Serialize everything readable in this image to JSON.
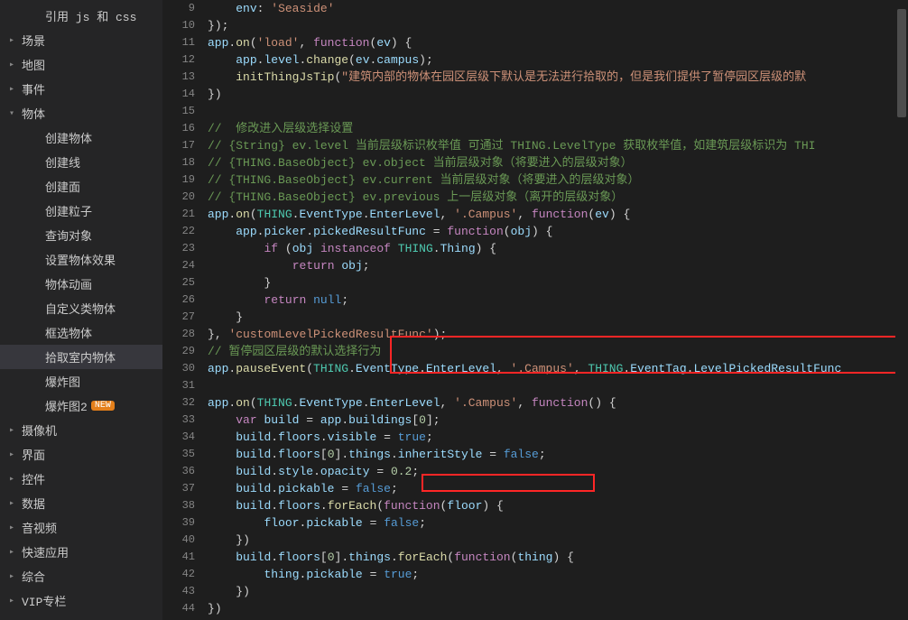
{
  "sidebar": {
    "items": [
      {
        "label": "引用 js 和 css",
        "arrow": "",
        "child": true
      },
      {
        "label": "场景",
        "arrow": "▸"
      },
      {
        "label": "地图",
        "arrow": "▸"
      },
      {
        "label": "事件",
        "arrow": "▸"
      },
      {
        "label": "物体",
        "arrow": "▾"
      },
      {
        "label": "创建物体",
        "arrow": "",
        "child": true
      },
      {
        "label": "创建线",
        "arrow": "",
        "child": true
      },
      {
        "label": "创建面",
        "arrow": "",
        "child": true
      },
      {
        "label": "创建粒子",
        "arrow": "",
        "child": true
      },
      {
        "label": "查询对象",
        "arrow": "",
        "child": true
      },
      {
        "label": "设置物体效果",
        "arrow": "",
        "child": true
      },
      {
        "label": "物体动画",
        "arrow": "",
        "child": true
      },
      {
        "label": "自定义类物体",
        "arrow": "",
        "child": true
      },
      {
        "label": "框选物体",
        "arrow": "",
        "child": true
      },
      {
        "label": "拾取室内物体",
        "arrow": "",
        "child": true,
        "selected": true
      },
      {
        "label": "爆炸图",
        "arrow": "",
        "child": true
      },
      {
        "label": "爆炸图2",
        "arrow": "",
        "child": true,
        "badge": "NEW"
      },
      {
        "label": "摄像机",
        "arrow": "▸"
      },
      {
        "label": "界面",
        "arrow": "▸"
      },
      {
        "label": "控件",
        "arrow": "▸"
      },
      {
        "label": "数据",
        "arrow": "▸"
      },
      {
        "label": "音视频",
        "arrow": "▸"
      },
      {
        "label": "快速应用",
        "arrow": "▸"
      },
      {
        "label": "综合",
        "arrow": "▸"
      },
      {
        "label": "VIP专栏",
        "arrow": "▸"
      }
    ]
  },
  "code": {
    "first_line": 9,
    "lines": [
      "    env: 'Seaside'",
      "});",
      "app.on('load', function(ev) {",
      "    app.level.change(ev.campus);",
      "    initThingJsTip(\"建筑内部的物体在园区层级下默认是无法进行拾取的，但是我们提供了暂停园区层级的默",
      "})",
      "",
      "//  修改进入层级选择设置",
      "// {String} ev.level 当前层级标识枚举值 可通过 THING.LevelType 获取枚举值，如建筑层级标识为 THI",
      "// {THING.BaseObject} ev.object 当前层级对象（将要进入的层级对象）",
      "// {THING.BaseObject} ev.current 当前层级对象（将要进入的层级对象）",
      "// {THING.BaseObject} ev.previous 上一层级对象（离开的层级对象）",
      "app.on(THING.EventType.EnterLevel, '.Campus', function(ev) {",
      "    app.picker.pickedResultFunc = function(obj) {",
      "        if (obj instanceof THING.Thing) {",
      "            return obj;",
      "        }",
      "        return null;",
      "    }",
      "}, 'customLevelPickedResultFunc');",
      "// 暂停园区层级的默认选择行为",
      "app.pauseEvent(THING.EventType.EnterLevel, '.Campus', THING.EventTag.LevelPickedResultFunc",
      "",
      "app.on(THING.EventType.EnterLevel, '.Campus', function() {",
      "    var build = app.buildings[0];",
      "    build.floors.visible = true;",
      "    build.floors[0].things.inheritStyle = false;",
      "    build.style.opacity = 0.2;",
      "    build.pickable = false;",
      "    build.floors.forEach(function(floor) {",
      "        floor.pickable = false;",
      "    })",
      "    build.floors[0].things.forEach(function(thing) {",
      "        thing.pickable = true;",
      "    })",
      "})"
    ]
  },
  "tokens": {
    "kw": [
      "function",
      "var",
      "if",
      "instanceof",
      "return"
    ],
    "con": [
      "true",
      "false",
      "null"
    ],
    "typ": [
      "THING"
    ],
    "mem": [
      "EventType",
      "EnterLevel",
      "EventTag",
      "LevelPickedResultFunc",
      "LevelType",
      "BaseObject",
      "Thing",
      "level",
      "campus",
      "picker",
      "pickedResultFunc",
      "buildings",
      "floors",
      "visible",
      "things",
      "inheritStyle",
      "style",
      "opacity",
      "pickable",
      "object",
      "current",
      "previous",
      "env"
    ],
    "fn": [
      "on",
      "change",
      "initThingJsTip",
      "pauseEvent",
      "forEach"
    ],
    "str_delims": [
      "'",
      "\""
    ]
  }
}
